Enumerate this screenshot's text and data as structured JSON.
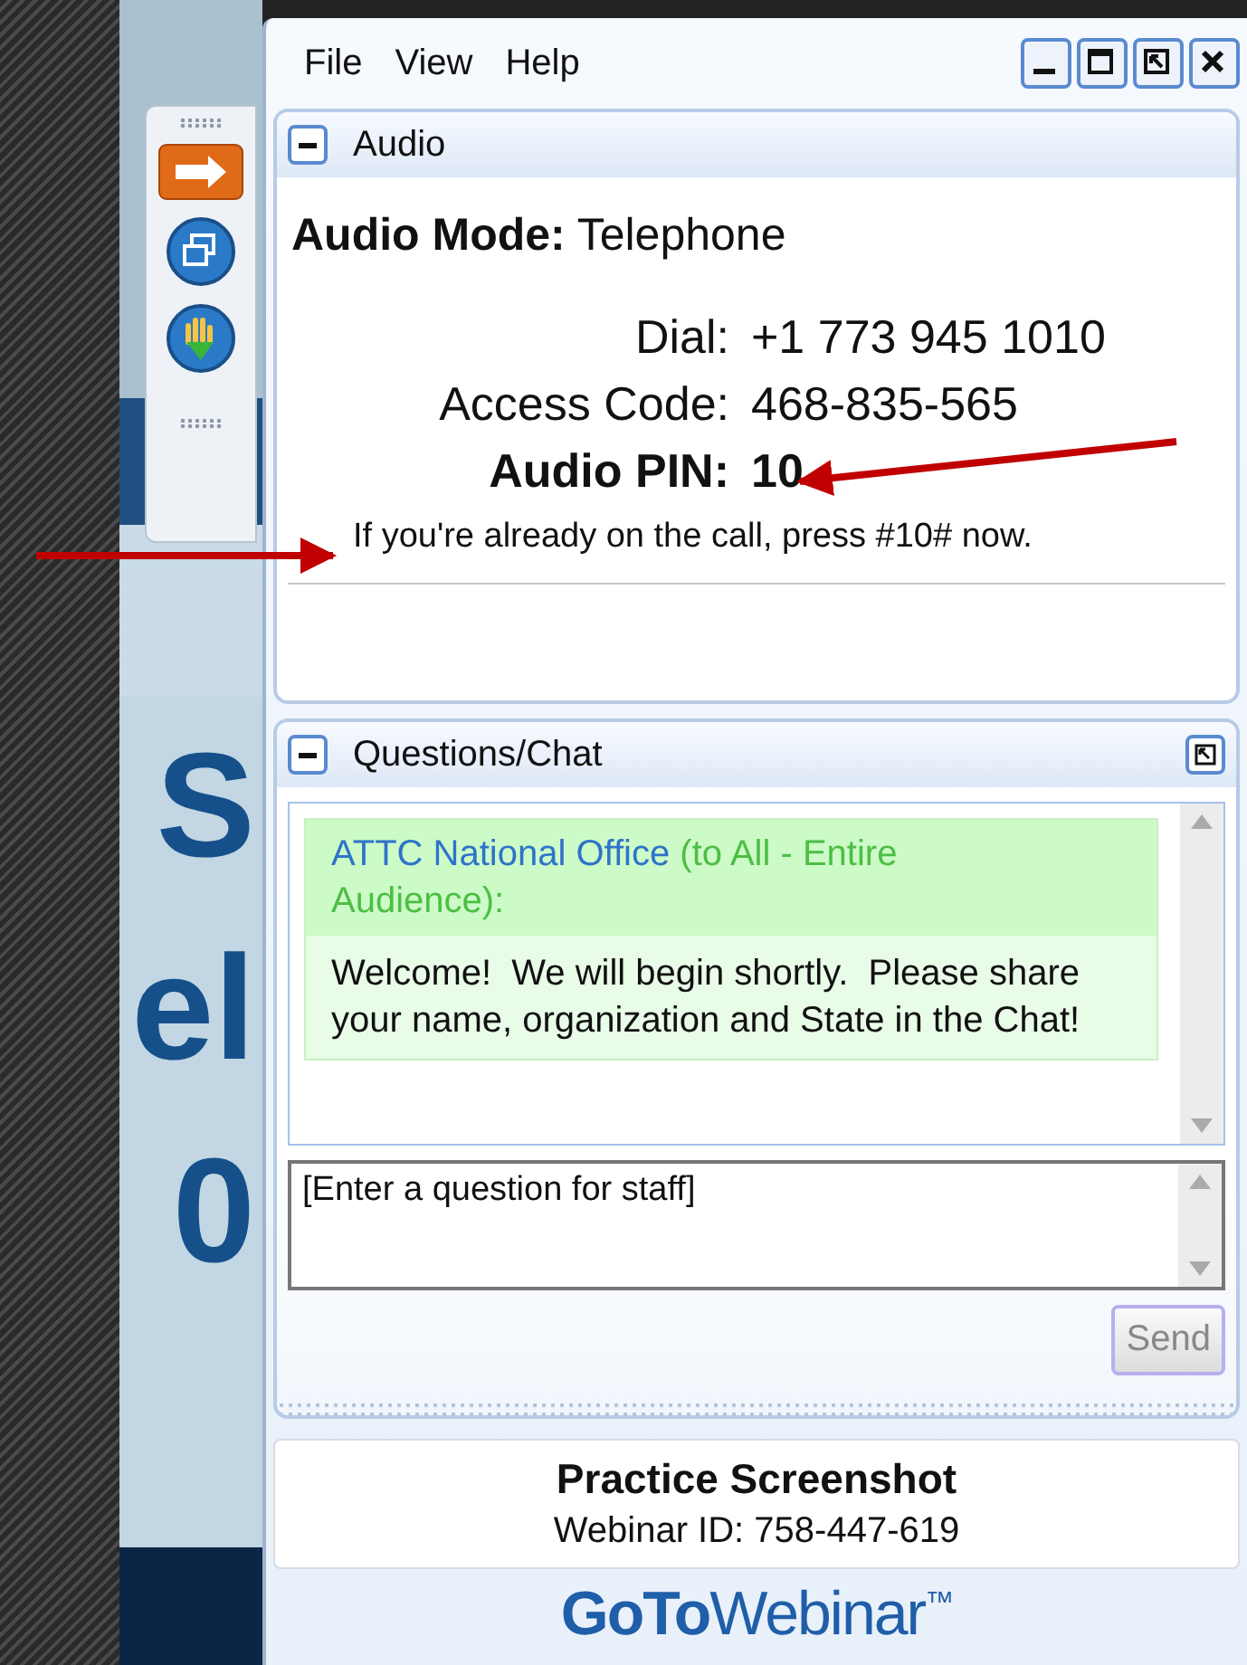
{
  "slide": {
    "fragments": [
      "S",
      "el",
      "0"
    ]
  },
  "menu": [
    "File",
    "View",
    "Help"
  ],
  "audio_panel": {
    "title": "Audio",
    "mode_label": "Audio Mode:",
    "mode": "Telephone",
    "details": [
      {
        "label": "Dial:",
        "value": "+1 773 945 1010",
        "emphasis": false
      },
      {
        "label": "Access Code:",
        "value": "468-835-565",
        "emphasis": false
      },
      {
        "label": "Audio PIN:",
        "value": "10",
        "emphasis": true
      }
    ],
    "note": "If you're already on the call, press #10# now."
  },
  "chat_panel": {
    "title": "Questions/Chat",
    "messages": [
      {
        "sender": "ATTC National Office",
        "audience": "(to All - Entire Audience):",
        "text": "Welcome!  We will begin shortly.  Please share your name, organization and State in the Chat!"
      }
    ],
    "input": {
      "placeholder": "[Enter a question for staff]"
    },
    "send_button": {
      "label": "Send",
      "disabled": true
    }
  },
  "footer": {
    "title": "Practice Screenshot",
    "webinar_id": "Webinar ID: 758-447-619"
  },
  "logo": "**GoTo**Webinar$^{™}$"
}
